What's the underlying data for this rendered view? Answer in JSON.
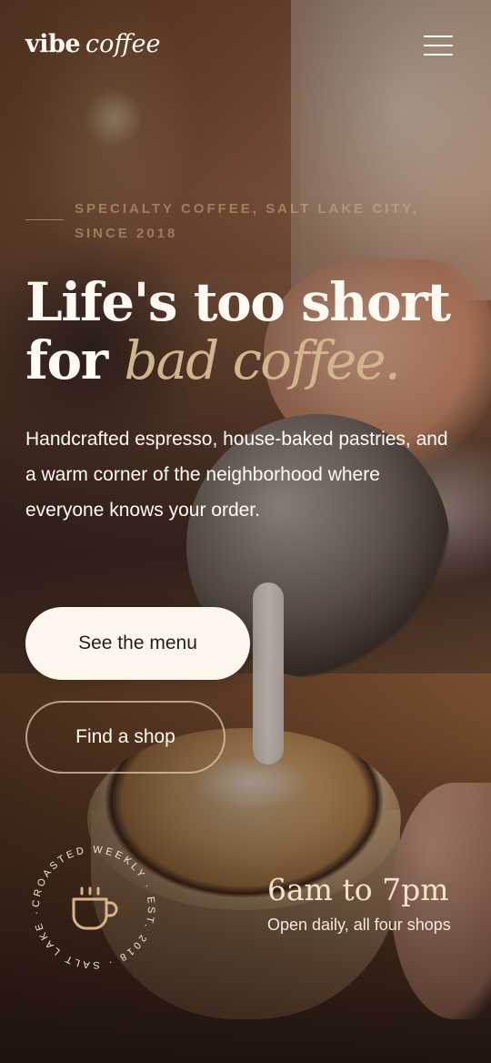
{
  "header": {
    "logo_bold": "vibe",
    "logo_italic": "coffee",
    "menu_icon": "hamburger-icon"
  },
  "hero": {
    "eyebrow": "Specialty coffee, Salt Lake City, since 2018",
    "headline_line1": "Life's too short",
    "headline_line2_plain": "for ",
    "headline_line2_accent": "bad coffee.",
    "lede": "Handcrafted espresso, house-baked pastries, and a warm corner of the neighborhood where everyone knows your order.",
    "primary_cta": "See the menu",
    "secondary_cta": "Find a shop"
  },
  "badge": {
    "ring_text": "CROASTED WEEKLY · EST. 2018 · SALT LAKE ·",
    "icon": "coffee-cup-icon"
  },
  "hours": {
    "time": "6am to 7pm",
    "note": "Open daily, all four shops"
  },
  "colors": {
    "accent": "#d2b48f",
    "cream": "#fdf6ea",
    "text_dark": "#2b1d14"
  }
}
